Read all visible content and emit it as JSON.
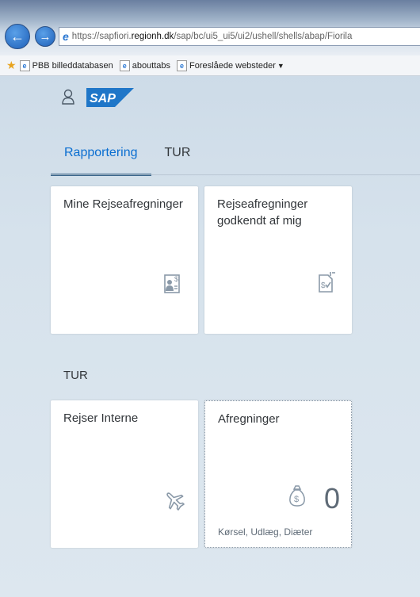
{
  "browser": {
    "url_prefix": "https://sapfiori.",
    "url_domain": "regionh.dk",
    "url_rest": "/sap/bc/ui5_ui5/ui2/ushell/shells/abap/Fiorila",
    "favorites": [
      {
        "label": "PBB billeddatabasen"
      },
      {
        "label": "abouttabs"
      },
      {
        "label": "Foreslåede websteder"
      }
    ]
  },
  "shell": {
    "logo_text": "SAP"
  },
  "tabs": [
    {
      "label": "Rapportering",
      "active": true
    },
    {
      "label": "TUR",
      "active": false
    }
  ],
  "group1": {
    "tiles": [
      {
        "title": "Mine Rejseafregninger",
        "icon": "employee-expense-icon"
      },
      {
        "title": "Rejseafregninger godkendt af mig",
        "icon": "approved-expense-icon"
      }
    ]
  },
  "group2": {
    "title": "TUR",
    "tiles": [
      {
        "title": "Rejser Interne",
        "icon": "airplane-icon"
      },
      {
        "title": "Afregninger",
        "icon": "money-bag-icon",
        "value": "0",
        "footer": "Kørsel, Udlæg, Diæter"
      }
    ]
  },
  "colors": {
    "accent": "#0a6ed1",
    "tab_underline": "#346187",
    "icon_gray": "#8a99a8"
  }
}
